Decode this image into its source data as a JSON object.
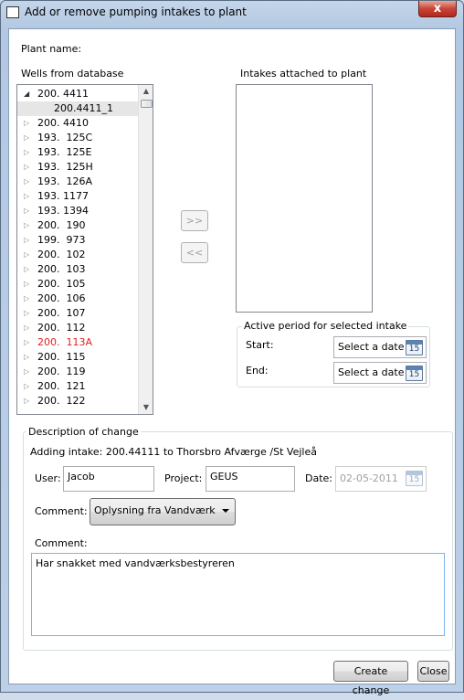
{
  "window": {
    "title": "Add or remove pumping intakes to plant",
    "close_glyph": "x"
  },
  "plant": {
    "name_label": "Plant name:"
  },
  "wells": {
    "label": "Wells from database",
    "items": [
      {
        "text": "200. 4411",
        "arrow": "◢",
        "expanded": true
      },
      {
        "text": "200.4411_1",
        "child": true,
        "selected": true
      },
      {
        "text": "200. 4410",
        "arrow": "▷"
      },
      {
        "text": "193.  125C",
        "arrow": "▷"
      },
      {
        "text": "193.  125E",
        "arrow": "▷"
      },
      {
        "text": "193.  125H",
        "arrow": "▷"
      },
      {
        "text": "193.  126A",
        "arrow": "▷"
      },
      {
        "text": "193. 1177",
        "arrow": "▷"
      },
      {
        "text": "193. 1394",
        "arrow": "▷"
      },
      {
        "text": "200.  190",
        "arrow": "▷"
      },
      {
        "text": "199.  973",
        "arrow": "▷"
      },
      {
        "text": "200.  102",
        "arrow": "▷"
      },
      {
        "text": "200.  103",
        "arrow": "▷"
      },
      {
        "text": "200.  105",
        "arrow": "▷"
      },
      {
        "text": "200.  106",
        "arrow": "▷"
      },
      {
        "text": "200.  107",
        "arrow": "▷"
      },
      {
        "text": "200.  112",
        "arrow": "▷"
      },
      {
        "text": "200.  113A",
        "arrow": "▷",
        "color": "#e02020"
      },
      {
        "text": "200.  115",
        "arrow": "▷"
      },
      {
        "text": "200.  119",
        "arrow": "▷"
      },
      {
        "text": "200.  121",
        "arrow": "▷"
      },
      {
        "text": "200.  122",
        "arrow": "▷"
      }
    ]
  },
  "transfer": {
    "add_label": ">>",
    "remove_label": "<<"
  },
  "intakes": {
    "label": "Intakes attached to plant"
  },
  "period": {
    "title": "Active period for selected intake",
    "start_label": "Start:",
    "end_label": "End:",
    "start_placeholder": "Select a date",
    "end_placeholder": "Select a date",
    "cal_day": "15"
  },
  "change": {
    "title": "Description of change",
    "summary": "Adding intake: 200.44111 to Thorsbro Afværge /St Vejleå",
    "user_label": "User:",
    "user_value": "Jacob",
    "project_label": "Project:",
    "project_value": "GEUS",
    "date_label": "Date:",
    "date_value": "02-05-2011",
    "comment_combo_label": "Comment:",
    "comment_combo_value": "Oplysning fra Vandværk",
    "comment_label": "Comment:",
    "comment_text": "Har snakket med vandværksbestyreren"
  },
  "actions": {
    "create_label": "Create change",
    "close_label": "Close"
  },
  "colors": {
    "accent": "#5b83b6",
    "error_text": "#e02020"
  }
}
